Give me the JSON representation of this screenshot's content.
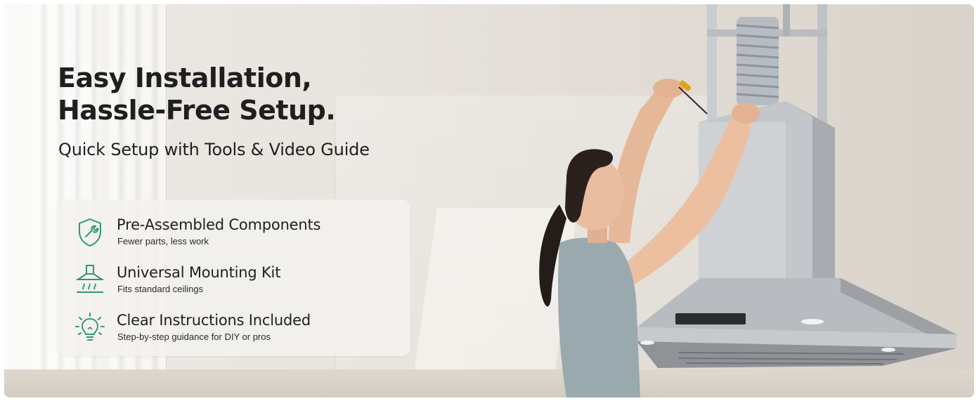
{
  "hero": {
    "title_line1": "Easy Installation,",
    "title_line2": "Hassle-Free Setup.",
    "subtitle": "Quick Setup with Tools & Video Guide"
  },
  "features": [
    {
      "icon": "shield-wrench-icon",
      "title": "Pre-Assembled Components",
      "subtitle": "Fewer parts, less work"
    },
    {
      "icon": "range-hood-icon",
      "title": "Universal Mounting Kit",
      "subtitle": "Fits standard ceilings"
    },
    {
      "icon": "lightbulb-icon",
      "title": "Clear Instructions Included",
      "subtitle": "Step-by-step guidance for DIY or pros"
    }
  ],
  "colors": {
    "icon_green": "#2f9a6e",
    "text_dark": "#1f1f1f"
  }
}
